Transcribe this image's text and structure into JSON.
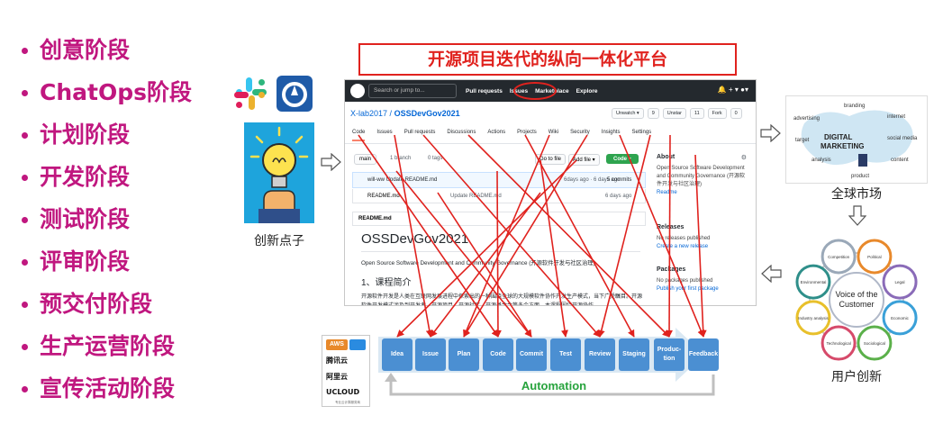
{
  "stages": [
    {
      "label": "创意阶段"
    },
    {
      "label": "ChatOps阶段"
    },
    {
      "label": "计划阶段"
    },
    {
      "label": "开发阶段"
    },
    {
      "label": "测试阶段"
    },
    {
      "label": "评审阶段"
    },
    {
      "label": "预交付阶段"
    },
    {
      "label": "生产运营阶段"
    },
    {
      "label": "宣传活动阶段"
    }
  ],
  "title": "开源项目迭代的纵向一体化平台",
  "idea_label": "创新点子",
  "market_label": "全球市场",
  "innovation_label": "用户创新",
  "automation_label": "Automation",
  "colors": {
    "stage": "#c0177f",
    "title": "#e0221e",
    "step": "#4b8fd2",
    "automation": "#27a33d",
    "idea_bg": "#1ea4dc"
  },
  "github": {
    "search_placeholder": "Search or jump to...",
    "nav": [
      "Pull requests",
      "Issues",
      "Marketplace",
      "Explore"
    ],
    "owner": "X-lab2017",
    "repo": "OSSDevGov2021",
    "badges": [
      "Unwatch ▾",
      "9",
      "Unstar",
      "11",
      "Fork",
      "0"
    ],
    "tabs": [
      "Code",
      "Issues",
      "Pull requests",
      "Discussions",
      "Actions",
      "Projects",
      "Wiki",
      "Security",
      "Insights",
      "Settings"
    ],
    "branch": "main",
    "branches": "1 branch",
    "tags": "0 tags",
    "go_to_file": "Go to file",
    "add_file": "Add file ▾",
    "code_btn": "Code ▾",
    "commit_msg": "will-ww Update README.md",
    "commit_time": "6days ago · 6 days ago",
    "commits": "5 commits",
    "file_name": "README.md",
    "file_msg": "Update README.md",
    "file_time": "6 days ago",
    "readme_header": "README.md",
    "h1": "OSSDevGov2021",
    "desc": "Open Source Software Development and Community Governance (开源软件开发与社区治理)",
    "h2": "1、课程简介",
    "body": "开源软件开发是人类在互联网发展进程中探索出的一种围绕全球的大规模软件协作开发生产模式，当下广受瞩目。开源软件开发模式涉及到开发者、开源项目、开源社区、开源基金会等多个方面。本课程围绕开源协作",
    "about_title": "About",
    "about_text": "Open Source Software Development and Community Governance (开源软件开发与社区治理)",
    "readme_link": "Readme",
    "releases_title": "Releases",
    "releases_text": "No releases published",
    "releases_link": "Create a new release",
    "packages_title": "Packages",
    "packages_text": "No packages published",
    "packages_link": "Publish your first package"
  },
  "pipeline": [
    {
      "label": "Idea"
    },
    {
      "label": "Issue"
    },
    {
      "label": "Plan"
    },
    {
      "label": "Code"
    },
    {
      "label": "Commit"
    },
    {
      "label": "Test"
    },
    {
      "label": "Review"
    },
    {
      "label": "Staging"
    },
    {
      "label": "Produc-\ntion"
    },
    {
      "label": "Feedback"
    }
  ],
  "cloud": {
    "aws": "AWS",
    "tencent": "腾讯云",
    "aliyun": "阿里云",
    "ucloud": "UCLOUD",
    "ucloud_tag": "专业云计算服务商"
  },
  "market_words": [
    "branding",
    "advertising",
    "internet",
    "DIGITAL",
    "MARKETING",
    "target",
    "social media",
    "analysis",
    "product",
    "content"
  ],
  "innovation_center": "Voice of the Customer",
  "innovation_petals": [
    "Political",
    "Legal",
    "Economic",
    "Sociological",
    "Technological",
    "Industry analysis",
    "Environmental",
    "Competition"
  ]
}
